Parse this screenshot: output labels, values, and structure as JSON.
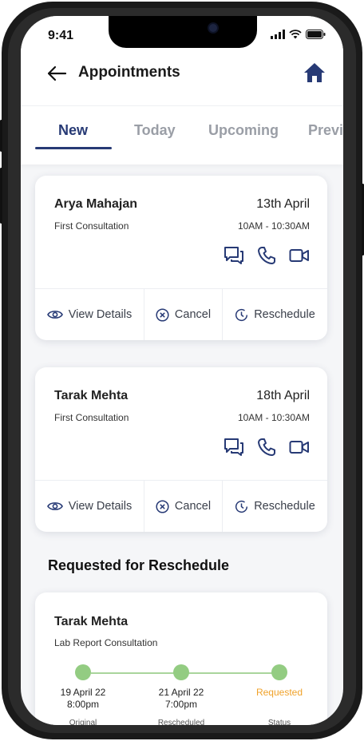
{
  "status_bar": {
    "time": "9:41"
  },
  "header": {
    "title": "Appointments"
  },
  "tabs": [
    "New",
    "Today",
    "Upcoming",
    "Previ"
  ],
  "appointments": [
    {
      "name": "Arya Mahajan",
      "type": "First Consultation",
      "date": "13th April",
      "time": "10AM - 10:30AM",
      "actions": {
        "view": "View Details",
        "cancel": "Cancel",
        "reschedule": "Reschedule"
      }
    },
    {
      "name": "Tarak Mehta",
      "type": "First Consultation",
      "date": "18th April",
      "time": "10AM - 10:30AM",
      "actions": {
        "view": "View Details",
        "cancel": "Cancel",
        "reschedule": "Reschedule"
      }
    }
  ],
  "reschedule_section": {
    "title": "Requested for Reschedule",
    "request": {
      "name": "Tarak Mehta",
      "type": "Lab Report Consultation",
      "steps": [
        {
          "date": "19 April 22",
          "time": "8:00pm",
          "caption": "Original"
        },
        {
          "date": "21 April 22",
          "time": "7:00pm",
          "caption": "Rescheduled"
        },
        {
          "status": "Requested",
          "caption": "Status"
        }
      ]
    }
  },
  "icons": {
    "back": "back-arrow-icon",
    "home": "home-icon",
    "chat": "chat-icon",
    "call": "phone-icon",
    "video": "video-icon",
    "view": "eye-icon",
    "cancel": "cancel-circle-icon",
    "reschedule": "clock-icon"
  },
  "colors": {
    "primary": "#273a75",
    "inactive_tab": "#9a9ea6",
    "timeline": "#93cc82",
    "status_requested": "#f0a22a"
  }
}
